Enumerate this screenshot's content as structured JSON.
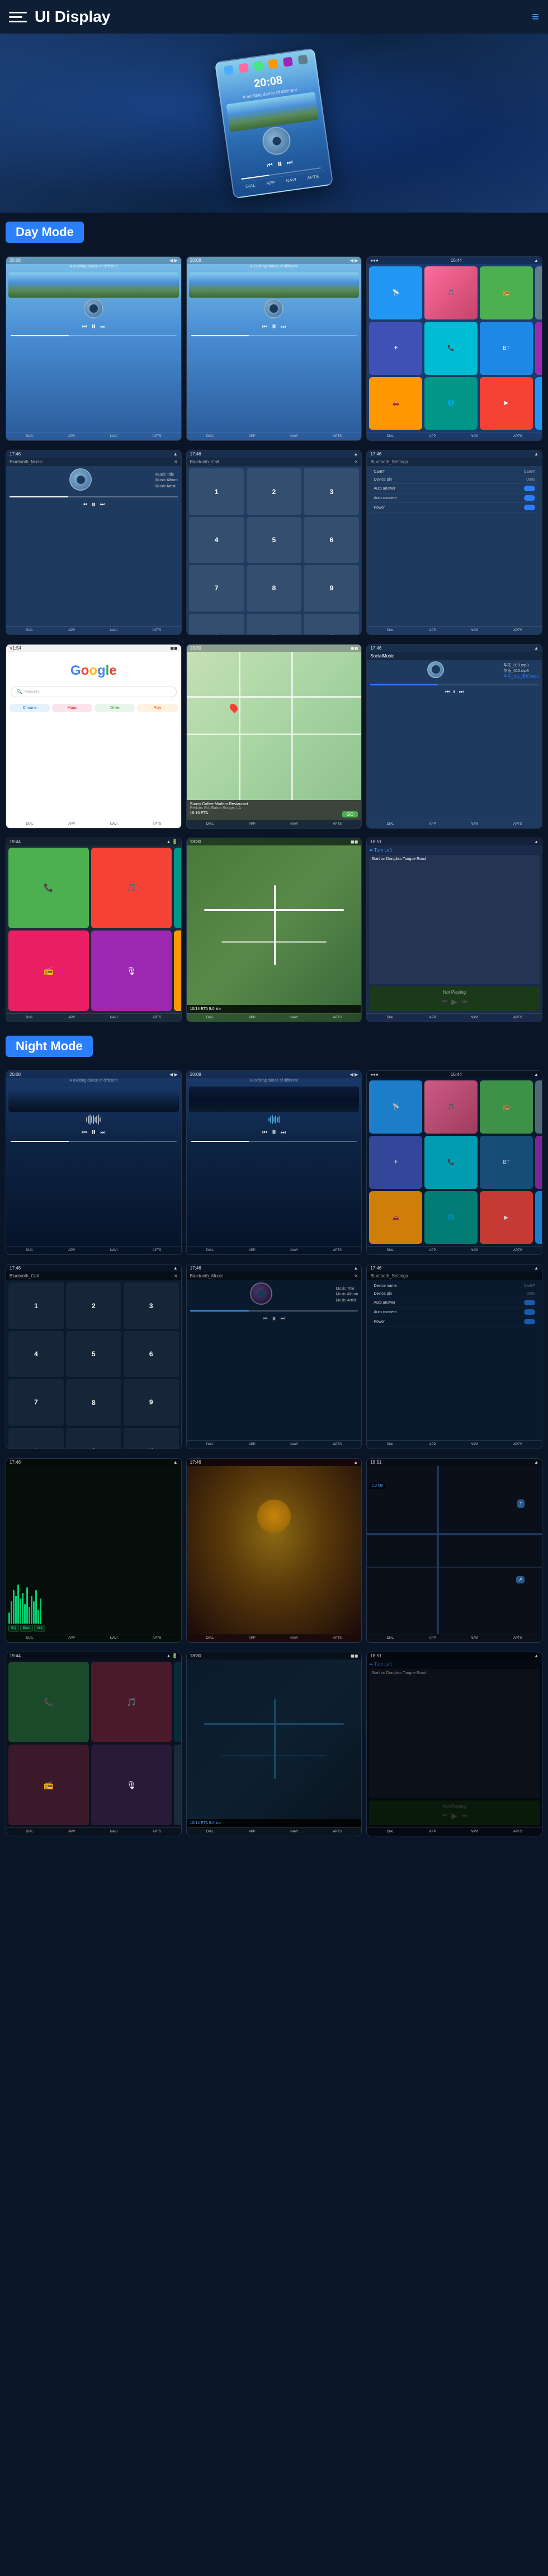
{
  "header": {
    "title": "UI Display",
    "menu_icon": "≡",
    "nav_icon": "≡"
  },
  "day_mode": {
    "title": "Day Mode"
  },
  "night_mode": {
    "title": "Night Mode"
  },
  "screens": {
    "time": "20:08",
    "subtitle": "A exciting dance of different",
    "music_title": "Music Title",
    "music_album": "Music Album",
    "music_artist": "Music Artist",
    "bluetooth_music": "Bluetooth_Music",
    "bluetooth_call": "Bluetooth_Call",
    "bluetooth_settings": "Bluetooth_Settings",
    "device_name": "CarBT",
    "device_pin": "0000",
    "auto_answer": "Auto answer",
    "auto_connect": "Auto connect",
    "power": "Power",
    "google": "Google",
    "search_placeholder": "Search...",
    "sunny_coffee": "Sunny Coffee Modern Restaurant",
    "address": "Perkins Rd, Baton Rouge, LA",
    "eta": "16:16 ETA",
    "distance": "10/14 ETA   9.0 km",
    "go": "GO",
    "not_playing": "Not Playing",
    "start_on": "Start on Dongliao Tongue Road",
    "bottom_labels": [
      "DIAL",
      "APP",
      "NAVI",
      "APTS"
    ]
  }
}
